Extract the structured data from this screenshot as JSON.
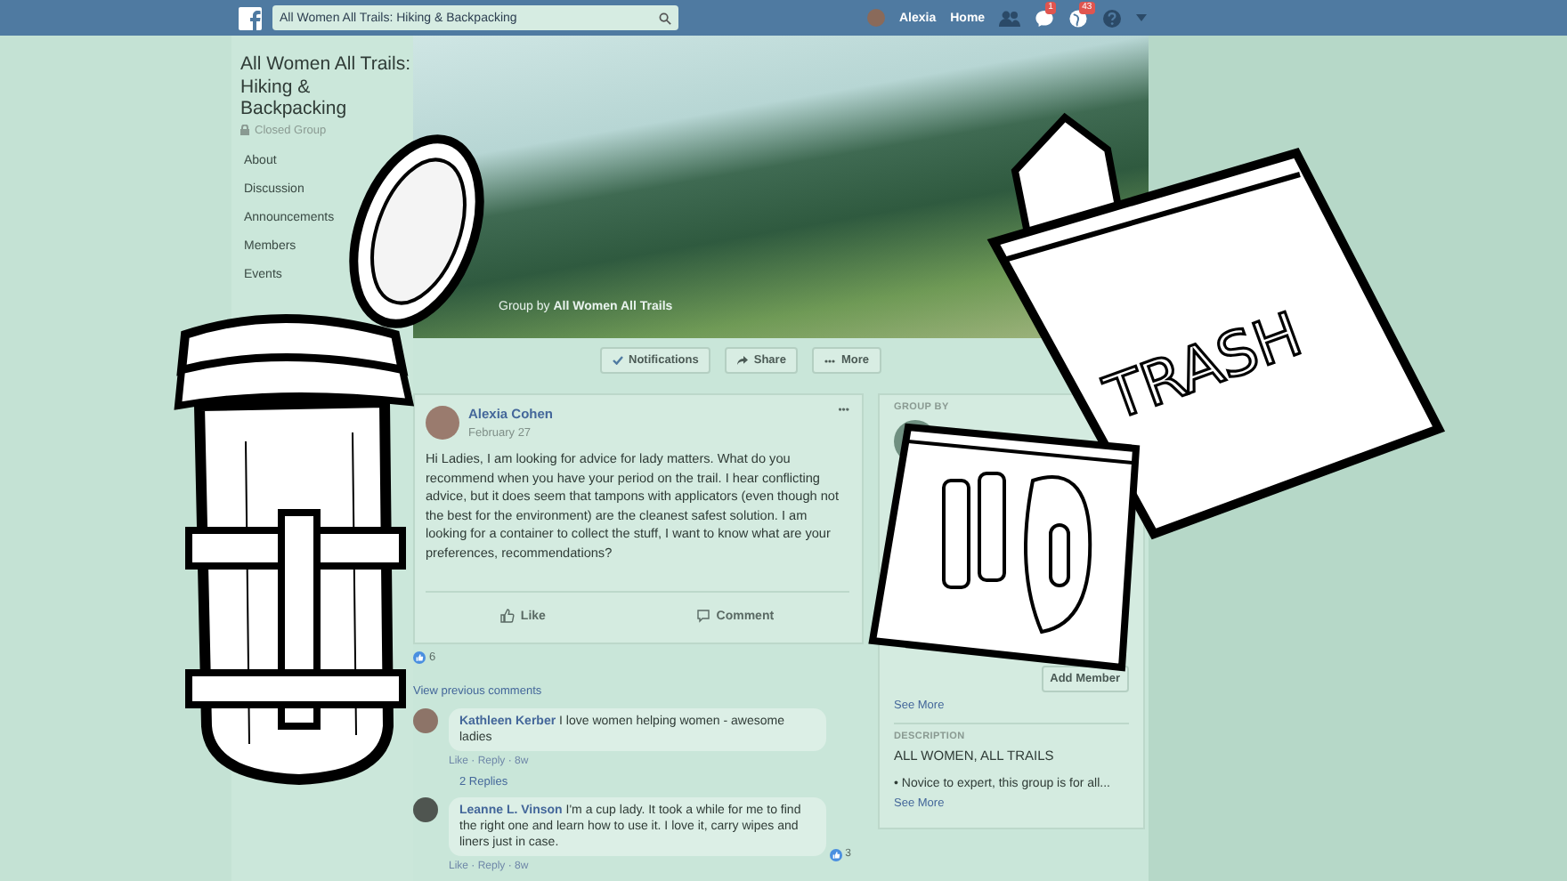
{
  "top_bar": {
    "search": {
      "value": "All Women All Trails: Hiking & Backpacking"
    },
    "user": "Alexia",
    "home": "Home",
    "badges": [
      {
        "kind": "messages",
        "count": "1"
      },
      {
        "kind": "notifications",
        "count": "43"
      }
    ]
  },
  "sidebar": {
    "group_title": "All Women All Trails: Hiking & Backpacking",
    "privacy": "Closed Group",
    "items": [
      {
        "label": "About"
      },
      {
        "label": "Discussion"
      },
      {
        "label": "Announcements"
      },
      {
        "label": "Members"
      },
      {
        "label": "Events"
      }
    ]
  },
  "cover": {
    "caption_prefix": "Group by",
    "caption_link": "All Women All Trails"
  },
  "actions": [
    {
      "kind": "check",
      "label": "Notifications"
    },
    {
      "kind": "share",
      "label": "Share"
    },
    {
      "kind": "more",
      "label": "More"
    }
  ],
  "post": {
    "author": "Alexia Cohen",
    "date": "February 27",
    "menu": "•••",
    "body": "Hi Ladies, I am looking for advice for lady matters. What do you recommend when you have your period on the trail. I hear conflicting advice, but it does seem that tampons with applicators (even though not the best for the environment) are the cleanest safest solution. I am looking for a container to collect the stuff, I want to know what are your preferences, recommendations?",
    "like": "Like",
    "comment": "Comment",
    "reactions": "6",
    "view_previous": "View previous comments",
    "comments": [
      {
        "author": "Kathleen Kerber",
        "text": "I love women helping women - awesome ladies",
        "meta": "Like · Reply · 8w",
        "replies": "2 Replies"
      },
      {
        "author": "Leanne L. Vinson",
        "text": "I'm a cup lady. It took a while for me to find the right one and learn how to use it. I love it, carry wipes and liners just in case.",
        "meta": "Like · Reply · 8w",
        "reactions": "3"
      }
    ]
  },
  "right_column": {
    "group_by_heading": "GROUP BY",
    "add_member": "Add Member",
    "members_see_more": "See More",
    "description_heading": "DESCRIPTION",
    "description_title": "ALL WOMEN, ALL TRAILS",
    "description": "• Novice to expert, this group is for all...",
    "description_see_more": "See More"
  },
  "illustration": {
    "bag_label": "TRASH"
  }
}
